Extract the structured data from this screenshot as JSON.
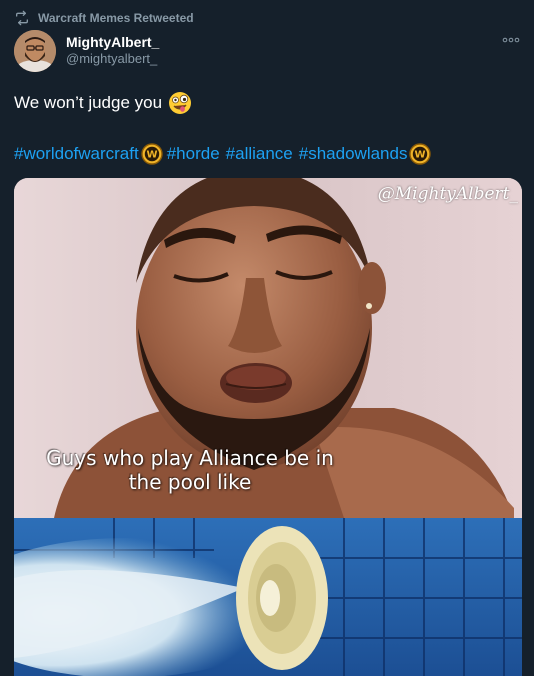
{
  "retweet": {
    "label": "Warcraft Memes Retweeted",
    "icon": "retweet-icon"
  },
  "author": {
    "display_name": "MightyAlbert_",
    "handle": "@mightyalbert_",
    "avatar_icon": "avatar"
  },
  "more_icon": "more-options-icon",
  "tweet": {
    "text": "We won’t judge you",
    "emoji": "zany-face-emoji",
    "hashtags": [
      "#worldofwarcraft",
      "#horde",
      "#alliance",
      "#shadowlands"
    ],
    "badge_icon": "warcraft-w-badge-icon"
  },
  "media": {
    "watermark": "@MightyAlbert_",
    "caption_line1": "Guys who play Alliance be in",
    "caption_line2": "the pool like"
  },
  "colors": {
    "background": "#15202b",
    "secondary_text": "#8899a6",
    "link": "#1da1f2"
  }
}
